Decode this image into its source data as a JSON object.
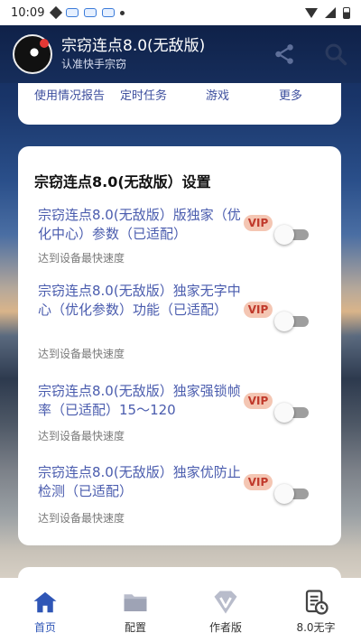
{
  "status_bar": {
    "time": "10:09"
  },
  "header": {
    "title": "宗窃连点8.0(无敌版)",
    "subtitle": "认准快手宗窃"
  },
  "top_menu": {
    "items": [
      {
        "label": "使用情况报告"
      },
      {
        "label": "定时任务"
      },
      {
        "label": "游戏"
      },
      {
        "label": "更多"
      }
    ]
  },
  "settings_card": {
    "title": "宗窃连点8.0(无敌版）设置",
    "items": [
      {
        "title": "宗窃连点8.0(无敌版）版独家（优化中心）参数（已适配）",
        "badge": "VIP",
        "desc": "达到设备最快速度",
        "enabled": false
      },
      {
        "title": "宗窃连点8.0(无敌版）独家无字中心（优化参数）功能（已适配）",
        "badge": "VIP",
        "desc": "达到设备最快速度",
        "enabled": false
      },
      {
        "title": "宗窃连点8.0(无敌版）独家强锁帧率（已适配）15～120",
        "badge": "VIP",
        "desc": "达到设备最快速度",
        "enabled": false
      },
      {
        "title": "宗窃连点8.0(无敌版）独家优防止检测（已适配）",
        "badge": "VIP",
        "desc": "达到设备最快速度",
        "enabled": false
      }
    ]
  },
  "bottom_nav": {
    "items": [
      {
        "label": "首页",
        "icon": "home-icon",
        "active": true
      },
      {
        "label": "配置",
        "icon": "folder-icon",
        "active": false
      },
      {
        "label": "作者版",
        "icon": "vip-v-icon",
        "active": false
      },
      {
        "label": "8.0无字",
        "icon": "document-clock-icon",
        "active": false
      }
    ]
  },
  "colors": {
    "accent": "#2f56b6",
    "setting_title": "#4a5cae",
    "vip_bg": "#f4c6b3",
    "vip_text": "#c0392b"
  }
}
